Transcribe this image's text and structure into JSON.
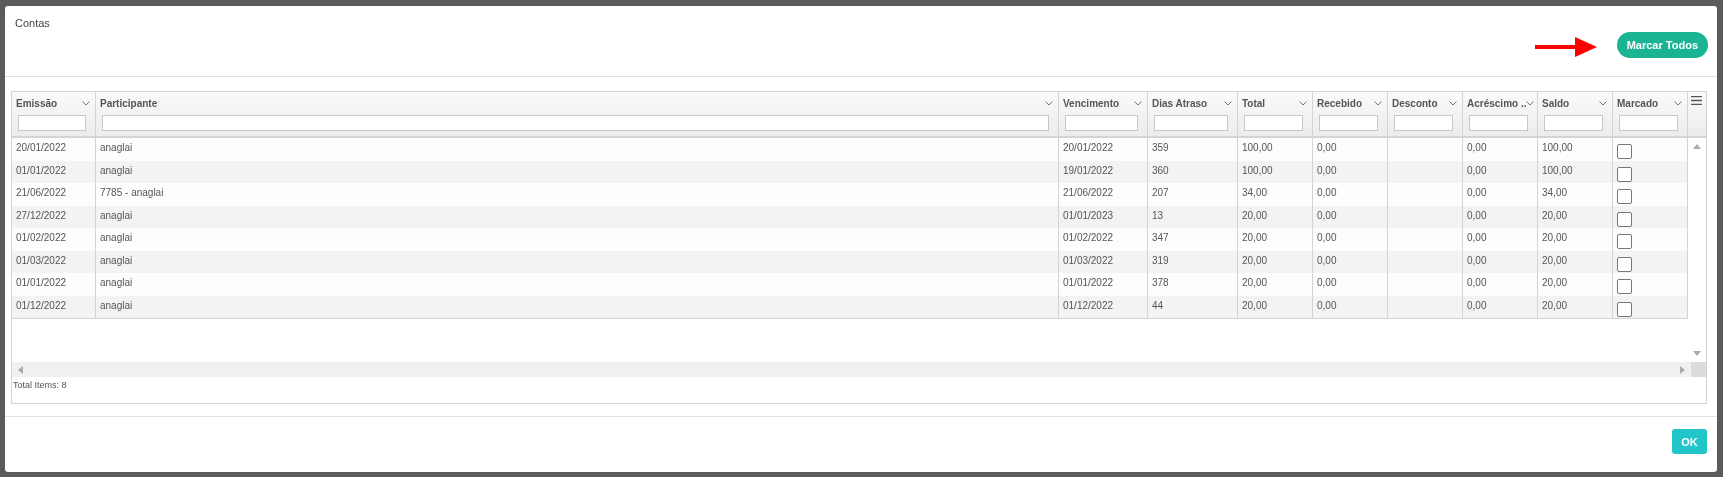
{
  "dialog": {
    "title": "Contas",
    "mark_all_button": "Marcar Todos",
    "ok_button": "OK"
  },
  "table": {
    "columns": [
      {
        "label": "Emissão"
      },
      {
        "label": "Participante"
      },
      {
        "label": "Vencimento"
      },
      {
        "label": "Dias Atraso"
      },
      {
        "label": "Total"
      },
      {
        "label": "Recebido"
      },
      {
        "label": "Desconto"
      },
      {
        "label": "Acréscimo .."
      },
      {
        "label": "Saldo"
      },
      {
        "label": "Marcado"
      }
    ],
    "rows": [
      {
        "cells": [
          "20/01/2022",
          "anaglai",
          "20/01/2022",
          "359",
          "100,00",
          "0,00",
          null,
          "0,00",
          "100,00"
        ],
        "marked": false
      },
      {
        "cells": [
          "01/01/2022",
          "anaglai",
          "19/01/2022",
          "360",
          "100,00",
          "0,00",
          null,
          "0,00",
          "100,00"
        ],
        "marked": false
      },
      {
        "cells": [
          "21/06/2022",
          "7785 - anaglai",
          "21/06/2022",
          "207",
          "34,00",
          "0,00",
          null,
          "0,00",
          "34,00"
        ],
        "marked": false
      },
      {
        "cells": [
          "27/12/2022",
          "anaglai",
          "01/01/2023",
          "13",
          "20,00",
          "0,00",
          null,
          "0,00",
          "20,00"
        ],
        "marked": false
      },
      {
        "cells": [
          "01/02/2022",
          "anaglai",
          "01/02/2022",
          "347",
          "20,00",
          "0,00",
          null,
          "0,00",
          "20,00"
        ],
        "marked": false
      },
      {
        "cells": [
          "01/03/2022",
          "anaglai",
          "01/03/2022",
          "319",
          "20,00",
          "0,00",
          null,
          "0,00",
          "20,00"
        ],
        "marked": false
      },
      {
        "cells": [
          "01/01/2022",
          "anaglai",
          "01/01/2022",
          "378",
          "20,00",
          "0,00",
          null,
          "0,00",
          "20,00"
        ],
        "marked": false
      },
      {
        "cells": [
          "01/12/2022",
          "anaglai",
          "01/12/2022",
          "44",
          "20,00",
          "0,00",
          null,
          "0,00",
          "20,00"
        ],
        "marked": false
      }
    ],
    "footer": "Total Items: 8"
  }
}
